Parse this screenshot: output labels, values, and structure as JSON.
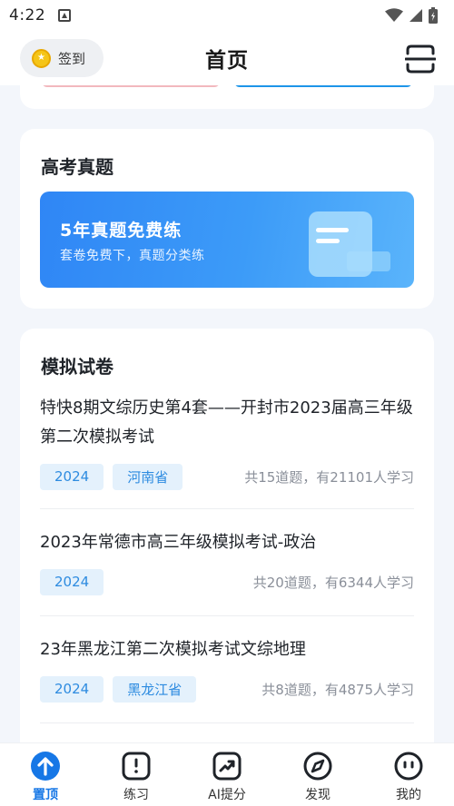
{
  "status_bar": {
    "time": "4:22"
  },
  "header": {
    "checkin_label": "签到",
    "title": "首页"
  },
  "gaokao": {
    "title": "高考真题",
    "banner_title": "5年真题免费练",
    "banner_subtitle": "套卷免费下，真题分类练"
  },
  "mock": {
    "title": "模拟试卷",
    "items": [
      {
        "title": "特快8期文综历史第4套——开封市2023届高三年级第二次模拟考试",
        "year": "2024",
        "province": "河南省",
        "stats": "共15道题，有21101人学习"
      },
      {
        "title": "2023年常德市高三年级模拟考试-政治",
        "year": "2024",
        "province": "",
        "stats": "共20道题，有6344人学习"
      },
      {
        "title": "23年黑龙江第二次模拟考试文综地理",
        "year": "2024",
        "province": "黑龙江省",
        "stats": "共8道题，有4875人学习"
      }
    ]
  },
  "nav": {
    "items": [
      {
        "label": "置顶",
        "icon": "arrow-up-circle-icon",
        "active": true
      },
      {
        "label": "练习",
        "icon": "practice-book-icon",
        "active": false
      },
      {
        "label": "AI提分",
        "icon": "trend-chart-icon",
        "active": false
      },
      {
        "label": "发现",
        "icon": "compass-icon",
        "active": false
      },
      {
        "label": "我的",
        "icon": "profile-face-icon",
        "active": false
      }
    ]
  },
  "colors": {
    "accent": "#1677e6",
    "tag_bg": "#e4f1fc",
    "tag_text": "#2d8be0",
    "banner": "#3c9bf8"
  }
}
